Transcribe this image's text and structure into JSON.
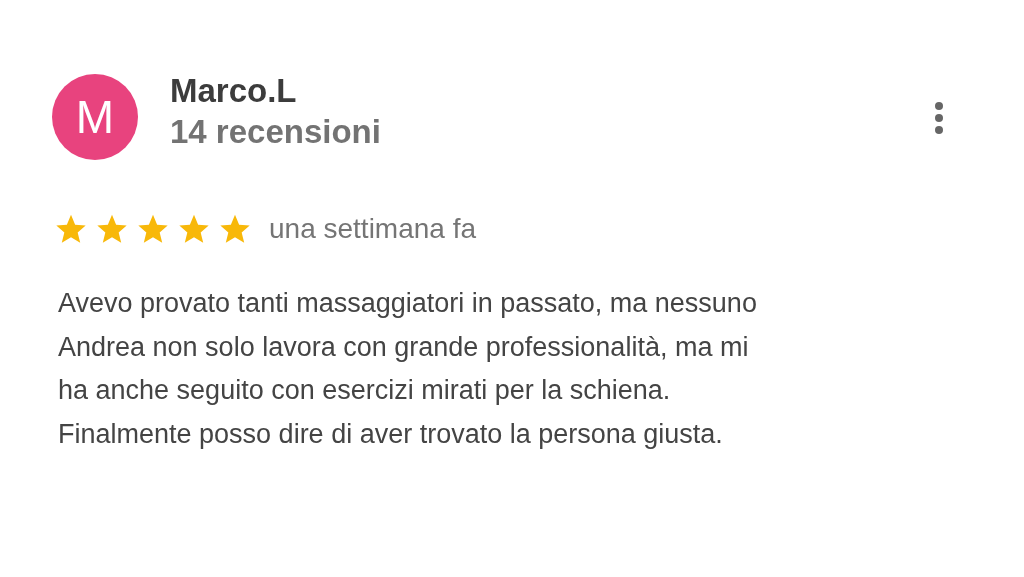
{
  "review": {
    "avatar_initial": "M",
    "author": "Marco.L",
    "review_count": "14 recensioni",
    "stars": 5,
    "date": "una settimana fa",
    "text": "Avevo provato tanti massaggiatori in passato, ma nessuno\nAndrea non solo lavora con grande professionalità, ma mi\nha anche seguito con esercizi mirati per la schiena.\nFinalmente posso dire di aver trovato la persona giusta."
  }
}
